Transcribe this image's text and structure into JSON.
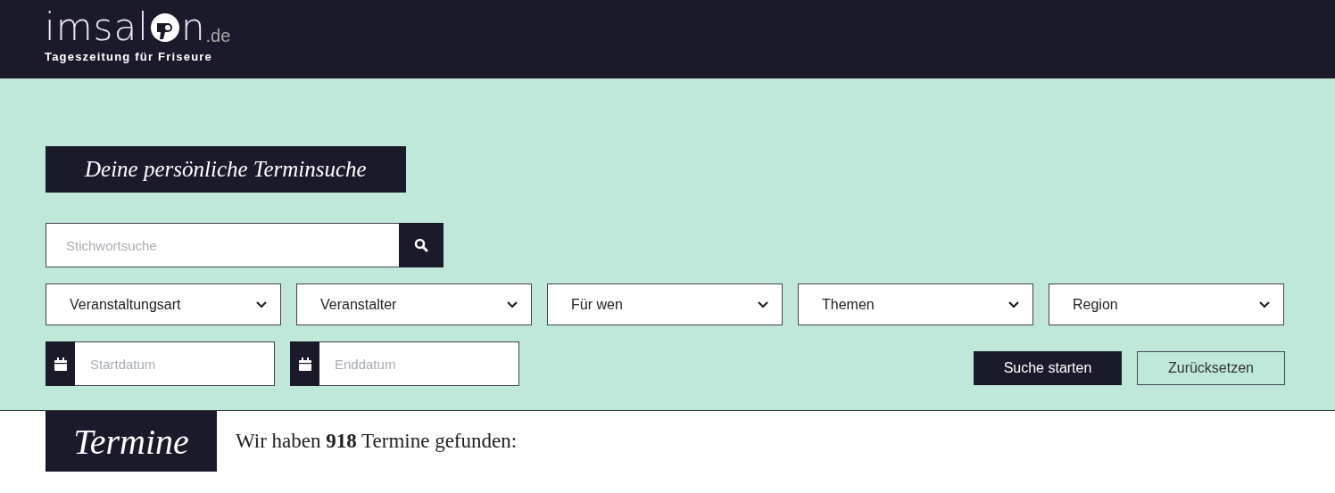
{
  "header": {
    "logo": {
      "part_before_icon": "imsal",
      "part_after_icon": "n",
      "domain": ".de"
    },
    "tagline": "Tageszeitung für Friseure"
  },
  "search_panel": {
    "title": "Deine persönliche Terminsuche",
    "keyword": {
      "placeholder": "Stichwortsuche"
    },
    "dropdowns": [
      {
        "label": "Veranstaltungsart"
      },
      {
        "label": "Veranstalter"
      },
      {
        "label": "Für wen"
      },
      {
        "label": "Themen"
      },
      {
        "label": "Region"
      }
    ],
    "dates": [
      {
        "placeholder": "Startdatum"
      },
      {
        "placeholder": "Enddatum"
      }
    ],
    "buttons": [
      {
        "label": "Suche starten",
        "kind": "primary"
      },
      {
        "label": "Zurücksetzen",
        "kind": "outline"
      }
    ]
  },
  "results": {
    "heading": "Termine",
    "summary": "Wir haben **918** Termine gefunden:"
  }
}
